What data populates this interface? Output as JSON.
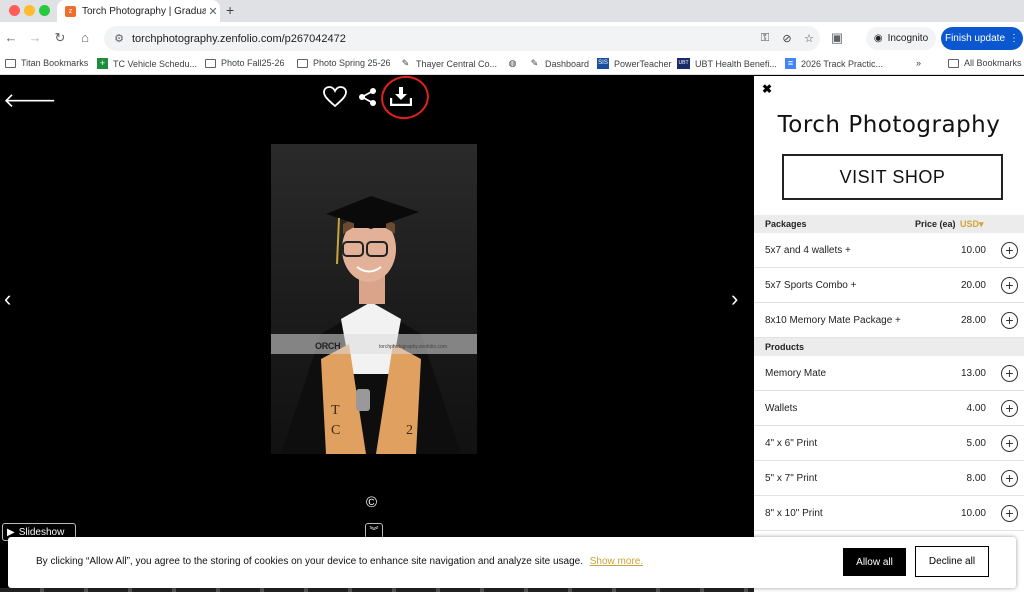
{
  "browser": {
    "tab_title": "Torch Photography | Graduati",
    "url": "torchphotography.zenfolio.com/p267042472",
    "incognito_label": "Incognito",
    "finish_update_label": "Finish update"
  },
  "bookmarks": [
    {
      "label": "Titan Bookmarks",
      "icon": "folder-icon"
    },
    {
      "label": "TC Vehicle Schedu...",
      "icon": "sheets-icon"
    },
    {
      "label": "Photo Fall25-26",
      "icon": "folder-icon"
    },
    {
      "label": "Photo Spring 25-26",
      "icon": "folder-icon"
    },
    {
      "label": "Thayer Central Co...",
      "icon": "pencil-icon"
    },
    {
      "label": "Dashboard",
      "icon": "pencil-icon"
    },
    {
      "label": "PowerTeacher",
      "icon": "sis-icon"
    },
    {
      "label": "UBT Health Benefi...",
      "icon": "ubt-icon"
    },
    {
      "label": "2026 Track Practic...",
      "icon": "docs-icon"
    },
    {
      "label": "All Bookmarks",
      "icon": "folder-icon"
    }
  ],
  "viewer": {
    "watermark_text": "ORCH",
    "watermark_url": "torchphotography.zenfolio.com",
    "copyright": "©",
    "slideshow_label": "Slideshow"
  },
  "shop": {
    "brand": "Torch Photography",
    "visit_shop_label": "VISIT SHOP",
    "packages_header": "Packages",
    "price_header": "Price (ea)",
    "currency": "USD",
    "packages": [
      {
        "name": "5x7 and 4 wallets +",
        "price": "10.00"
      },
      {
        "name": "5x7 Sports Combo +",
        "price": "20.00"
      },
      {
        "name": "8x10 Memory Mate Package +",
        "price": "28.00"
      }
    ],
    "products_header": "Products",
    "products": [
      {
        "name": "Memory Mate",
        "price": "13.00"
      },
      {
        "name": "Wallets",
        "price": "4.00"
      },
      {
        "name": "4\" x 6\" Print",
        "price": "5.00"
      },
      {
        "name": "5\" x 7\" Print",
        "price": "8.00"
      },
      {
        "name": "8\" x 10\" Print",
        "price": "10.00"
      }
    ]
  },
  "cookie": {
    "message": "By clicking “Allow All”, you agree to the storing of cookies on your device to enhance site navigation and analyze site usage.",
    "show_more": "Show more.",
    "allow_label": "Allow all",
    "decline_label": "Decline all"
  },
  "colors": {
    "accent_blue": "#0b57d0",
    "currency_gold": "#d4a33a",
    "annotation_red": "#e0211b"
  }
}
